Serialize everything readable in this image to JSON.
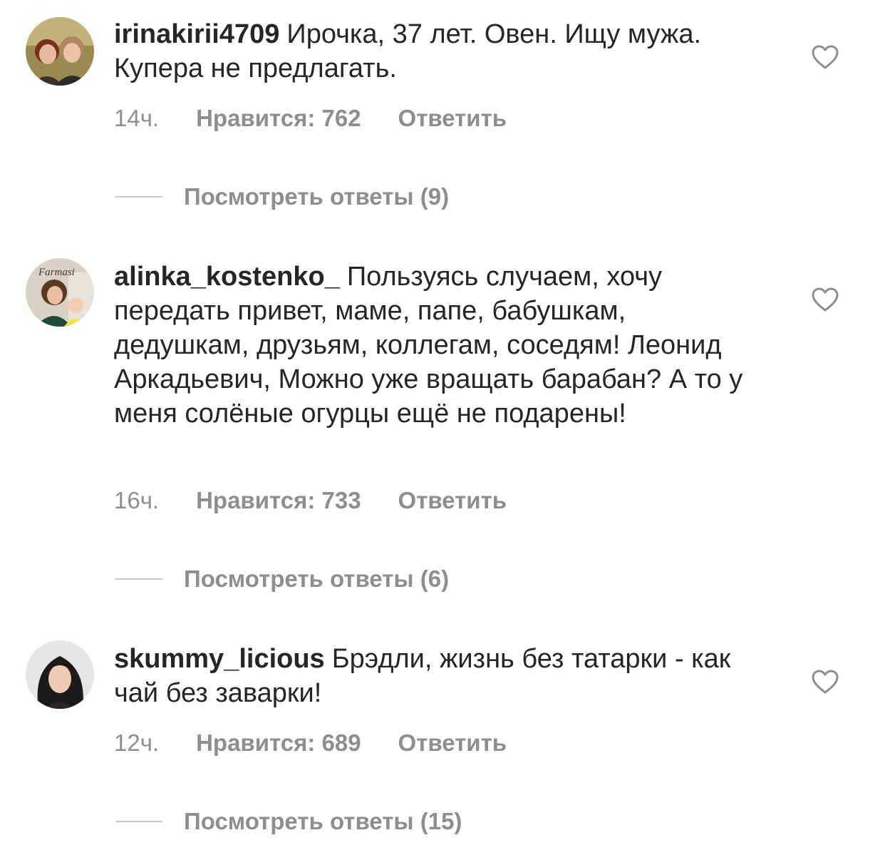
{
  "comments": [
    {
      "username": "irinakirii4709",
      "text": "Ирочка, 37 лет. Овен. Ищу мужа. Купера не предлагать.",
      "time": "14ч.",
      "likes": "Нравится: 762",
      "reply": "Ответить",
      "view_replies": "Посмотреть ответы (9)",
      "avatar_icon": "two-women-photo"
    },
    {
      "username": "alinka_kostenko_",
      "text": "Пользуясь случаем, хочу передать привет, маме, папе, бабушкам, дедушкам, друзьям, коллегам, соседям! Леонид Аркадьевич, Можно уже вращать барабан? А то у меня солёные огурцы ещё не подарены!",
      "time": "16ч.",
      "likes": "Нравится: 733",
      "reply": "Ответить",
      "view_replies": "Посмотреть ответы (6)",
      "avatar_icon": "woman-with-baby-photo",
      "avatar_badge": "Farmasi"
    },
    {
      "username": "skummy_licious",
      "text": "Брэдли, жизнь без татарки - как чай без заварки!",
      "time": "12ч.",
      "likes": "Нравится: 689",
      "reply": "Ответить",
      "view_replies": "Посмотреть ответы (15)",
      "avatar_icon": "woman-portrait-photo"
    }
  ],
  "colors": {
    "text": "#262626",
    "secondary": "#8e8e8e",
    "divider": "#c7c7c7"
  }
}
